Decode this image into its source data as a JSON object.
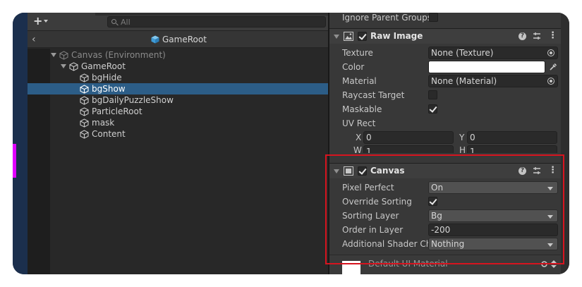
{
  "hierarchy": {
    "search_placeholder": "All",
    "prefab_title": "GameRoot",
    "tree": [
      {
        "label": "Canvas (Environment)",
        "dim": true
      },
      {
        "label": "GameRoot"
      },
      {
        "label": "bgHide"
      },
      {
        "label": "bgShow",
        "selected": true
      },
      {
        "label": "bgDailyPuzzleShow"
      },
      {
        "label": "ParticleRoot"
      },
      {
        "label": "mask"
      },
      {
        "label": "Content"
      }
    ]
  },
  "inspector": {
    "ignore_parent_groups": "Ignore Parent Groups",
    "raw_image": {
      "title": "Raw Image",
      "texture_label": "Texture",
      "texture_value": "None (Texture)",
      "color_label": "Color",
      "color_value": "#ffffff",
      "material_label": "Material",
      "material_value": "None (Material)",
      "raycast_label": "Raycast Target",
      "maskable_label": "Maskable",
      "uvrect_label": "UV Rect",
      "x_label": "X",
      "x_value": "0",
      "y_label": "Y",
      "y_value": "0",
      "w_label": "W",
      "w_value": "1",
      "h_label": "H",
      "h_value": "1"
    },
    "canvas": {
      "title": "Canvas",
      "pixel_perfect_label": "Pixel Perfect",
      "pixel_perfect_value": "On",
      "override_sorting_label": "Override Sorting",
      "sorting_layer_label": "Sorting Layer",
      "sorting_layer_value": "Bg",
      "order_in_layer_label": "Order in Layer",
      "order_in_layer_value": "-200",
      "shader_channels_label": "Additional Shader Ch",
      "shader_channels_value": "Nothing"
    },
    "material_preview": "Default UI Material"
  },
  "icons": {
    "help": "?",
    "more": "⋮",
    "back": "‹",
    "add": "+"
  },
  "colors": {
    "selection": "#2c5d87",
    "highlight_box": "#d7141f",
    "marker": "#e100ff"
  }
}
